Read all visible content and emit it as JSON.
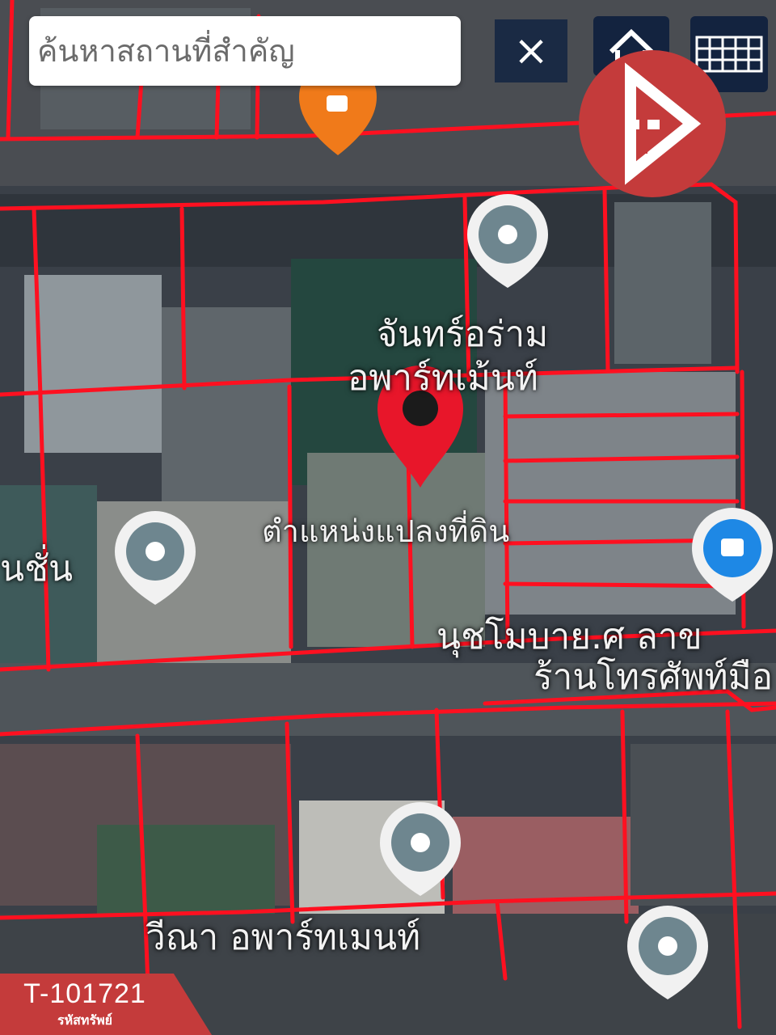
{
  "search": {
    "placeholder": "ค้นหาสถานที่สำคัญ",
    "clear_glyph": "×"
  },
  "map": {
    "labels": [
      "จันทร์อร่าม",
      "อพาร์ทเม้นท์",
      "ตำแหน่งแปลงที่ดิน",
      "นชั่น",
      "นุชโมบาย.ศ ลาข",
      "ร้านโทรศัพท์มือ",
      "วีณา อพาร์ทเมนท์"
    ],
    "parcel_line_color": "#ff1020",
    "pin_color": "#e8162a"
  },
  "brand": {
    "color": "#c43b3b",
    "icon": "brand-logo-icon"
  },
  "badge": {
    "code": "T-101721",
    "caption": "รหัสทรัพย์"
  }
}
